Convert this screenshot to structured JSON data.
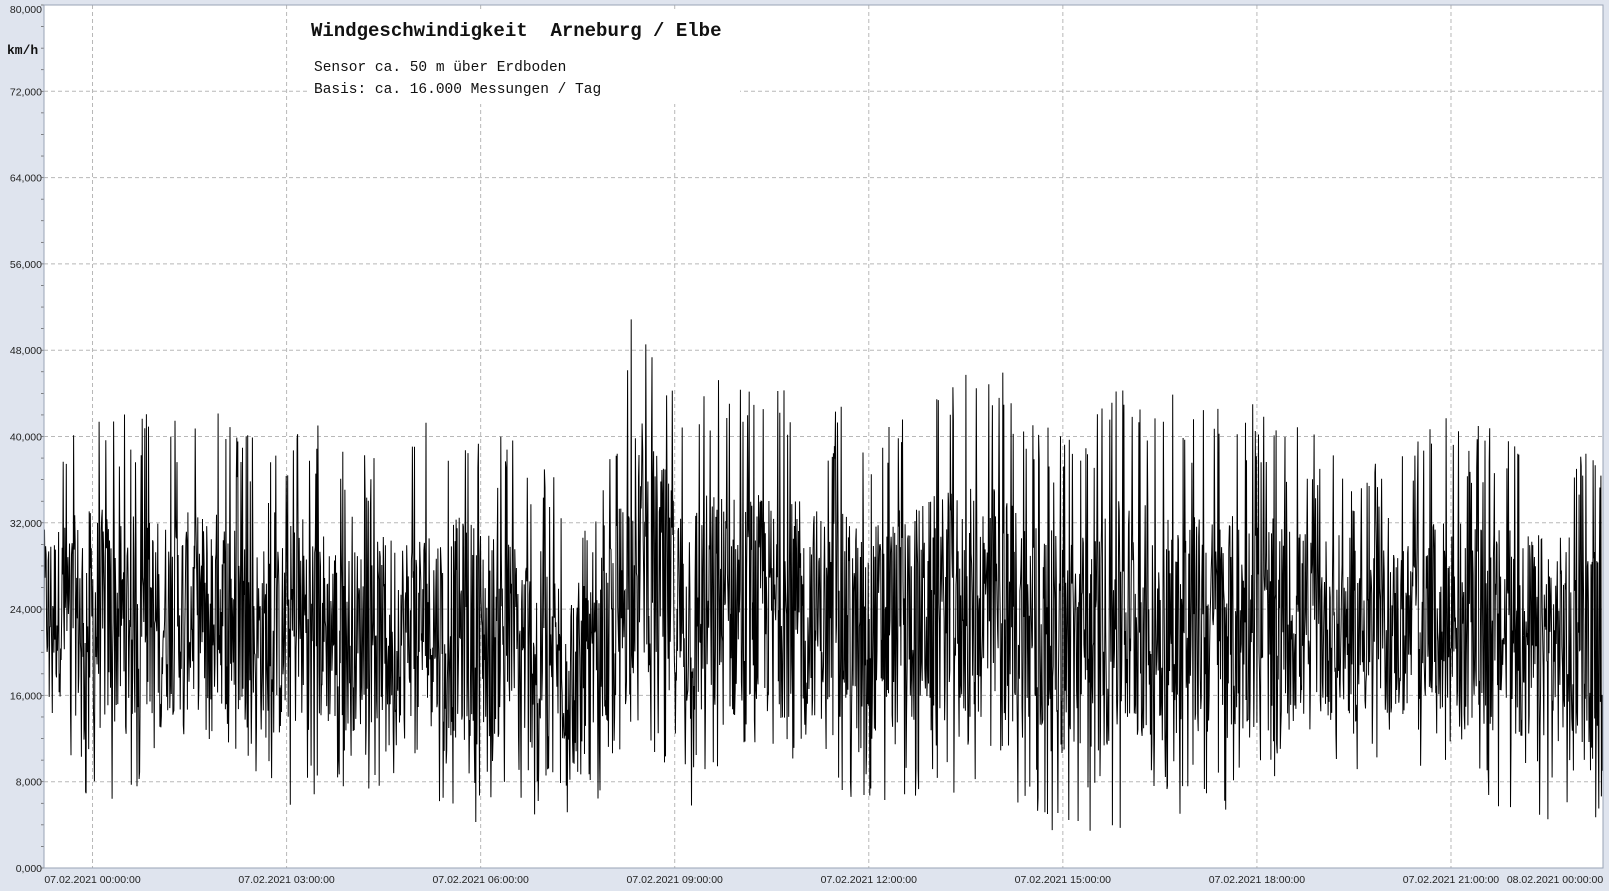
{
  "colors": {
    "background": "#dfe4ee",
    "plot_background": "#ffffff",
    "grid": "#b8b8b8",
    "series": "#000000",
    "text": "#111111"
  },
  "chart_data": {
    "type": "line",
    "title": "Windgeschwindigkeit  Arneburg / Elbe",
    "subtitle_lines": [
      "Sensor ca. 50 m über Erdboden",
      "Basis: ca. 16.000 Messungen / Tag"
    ],
    "ylabel": "km/h",
    "xlabel": "",
    "ylim": [
      0,
      80
    ],
    "xlim_hours": [
      -0.75,
      23.35
    ],
    "y_ticks": [
      "0,000",
      "8,000",
      "16,000",
      "24,000",
      "32,000",
      "40,000",
      "48,000",
      "56,000",
      "64,000",
      "72,000",
      "80,000"
    ],
    "x_ticks": [
      {
        "hour": 0,
        "label": "07.02.2021  00:00:00"
      },
      {
        "hour": 3,
        "label": "07.02.2021  03:00:00"
      },
      {
        "hour": 6,
        "label": "07.02.2021  06:00:00"
      },
      {
        "hour": 9,
        "label": "07.02.2021  09:00:00"
      },
      {
        "hour": 12,
        "label": "07.02.2021  12:00:00"
      },
      {
        "hour": 15,
        "label": "07.02.2021  15:00:00"
      },
      {
        "hour": 18,
        "label": "07.02.2021  18:00:00"
      },
      {
        "hour": 21,
        "label": "07.02.2021  21:00:00"
      },
      {
        "hour": 24,
        "label": "08.02.2021  00:00:00"
      }
    ],
    "grid": true,
    "series": [
      {
        "name": "",
        "summary_points": [
          {
            "hour": -0.75,
            "low": 14,
            "high": 39
          },
          {
            "hour": 0,
            "low": 5,
            "high": 44
          },
          {
            "hour": 1,
            "low": 8,
            "high": 42
          },
          {
            "hour": 2,
            "low": 9,
            "high": 43
          },
          {
            "hour": 2.8,
            "low": 5,
            "high": 38
          },
          {
            "hour": 3.2,
            "low": 6,
            "high": 44
          },
          {
            "hour": 4,
            "low": 7,
            "high": 38
          },
          {
            "hour": 5,
            "low": 8,
            "high": 41
          },
          {
            "hour": 5.8,
            "low": 4,
            "high": 43
          },
          {
            "hour": 6.3,
            "low": 5,
            "high": 41
          },
          {
            "hour": 7,
            "low": 4,
            "high": 38
          },
          {
            "hour": 7.8,
            "low": 5,
            "high": 32
          },
          {
            "hour": 8.3,
            "low": 8,
            "high": 50
          },
          {
            "hour": 8.45,
            "low": 14,
            "high": 55
          },
          {
            "hour": 9,
            "low": 5,
            "high": 46
          },
          {
            "hour": 10,
            "low": 6,
            "high": 46
          },
          {
            "hour": 11,
            "low": 8,
            "high": 44
          },
          {
            "hour": 12,
            "low": 5,
            "high": 42
          },
          {
            "hour": 13,
            "low": 7,
            "high": 45
          },
          {
            "hour": 14,
            "low": 6,
            "high": 47
          },
          {
            "hour": 15,
            "low": 3,
            "high": 40
          },
          {
            "hour": 16,
            "low": 3,
            "high": 46
          },
          {
            "hour": 17,
            "low": 5,
            "high": 43
          },
          {
            "hour": 18,
            "low": 5,
            "high": 43
          },
          {
            "hour": 19,
            "low": 8,
            "high": 40
          },
          {
            "hour": 20,
            "low": 9,
            "high": 38
          },
          {
            "hour": 21,
            "low": 8,
            "high": 42
          },
          {
            "hour": 22,
            "low": 4,
            "high": 41
          },
          {
            "hour": 23,
            "low": 5,
            "high": 40
          },
          {
            "hour": 23.35,
            "low": 4,
            "high": 38
          }
        ]
      }
    ]
  }
}
